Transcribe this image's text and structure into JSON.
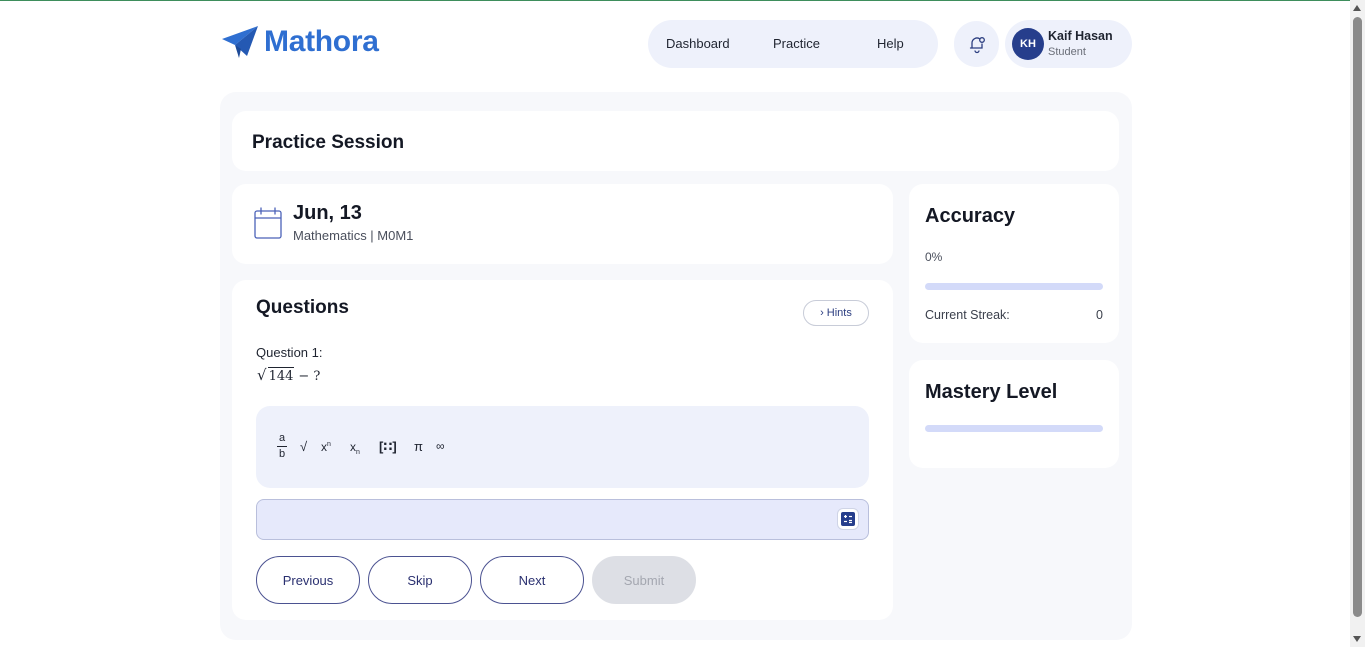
{
  "brand": {
    "name": "Mathora",
    "color": "#2f6fd1"
  },
  "nav": {
    "items": [
      "Dashboard",
      "Practice",
      "Help"
    ]
  },
  "user": {
    "initials": "KH",
    "name": "Kaif Hasan",
    "role": "Student"
  },
  "icons": {
    "logo": "paper-plane-icon",
    "notifications": "bell-icon",
    "calendar": "calendar-icon",
    "keyboard": "math-keyboard-icon"
  },
  "page": {
    "title": "Practice Session"
  },
  "session": {
    "date": "Jun, 13",
    "subtitle": "Mathematics | M0M1"
  },
  "questions": {
    "title": "Questions",
    "hints_label": "Hints",
    "current_label": "Question 1:",
    "expression": {
      "radicand": "144",
      "rest": "− ?"
    }
  },
  "toolbar": {
    "fraction": {
      "numerator": "a",
      "denominator": "b"
    },
    "sqrt": "√",
    "superscript": {
      "base": "x",
      "script": "n"
    },
    "subscript": {
      "base": "x",
      "script": "n"
    },
    "matrix": "[∷]",
    "pi": "π",
    "infinity": "∞"
  },
  "answer": {
    "value": ""
  },
  "buttons": {
    "previous": "Previous",
    "skip": "Skip",
    "next": "Next",
    "submit": "Submit"
  },
  "accuracy": {
    "title": "Accuracy",
    "value_text": "0%",
    "value": 0,
    "streak_label": "Current Streak:",
    "streak_value": "0"
  },
  "mastery": {
    "title": "Mastery Level",
    "value": 0
  },
  "colors": {
    "accent": "#263e8c",
    "progress_track": "#d3daf9",
    "panel": "#eef1fb"
  }
}
